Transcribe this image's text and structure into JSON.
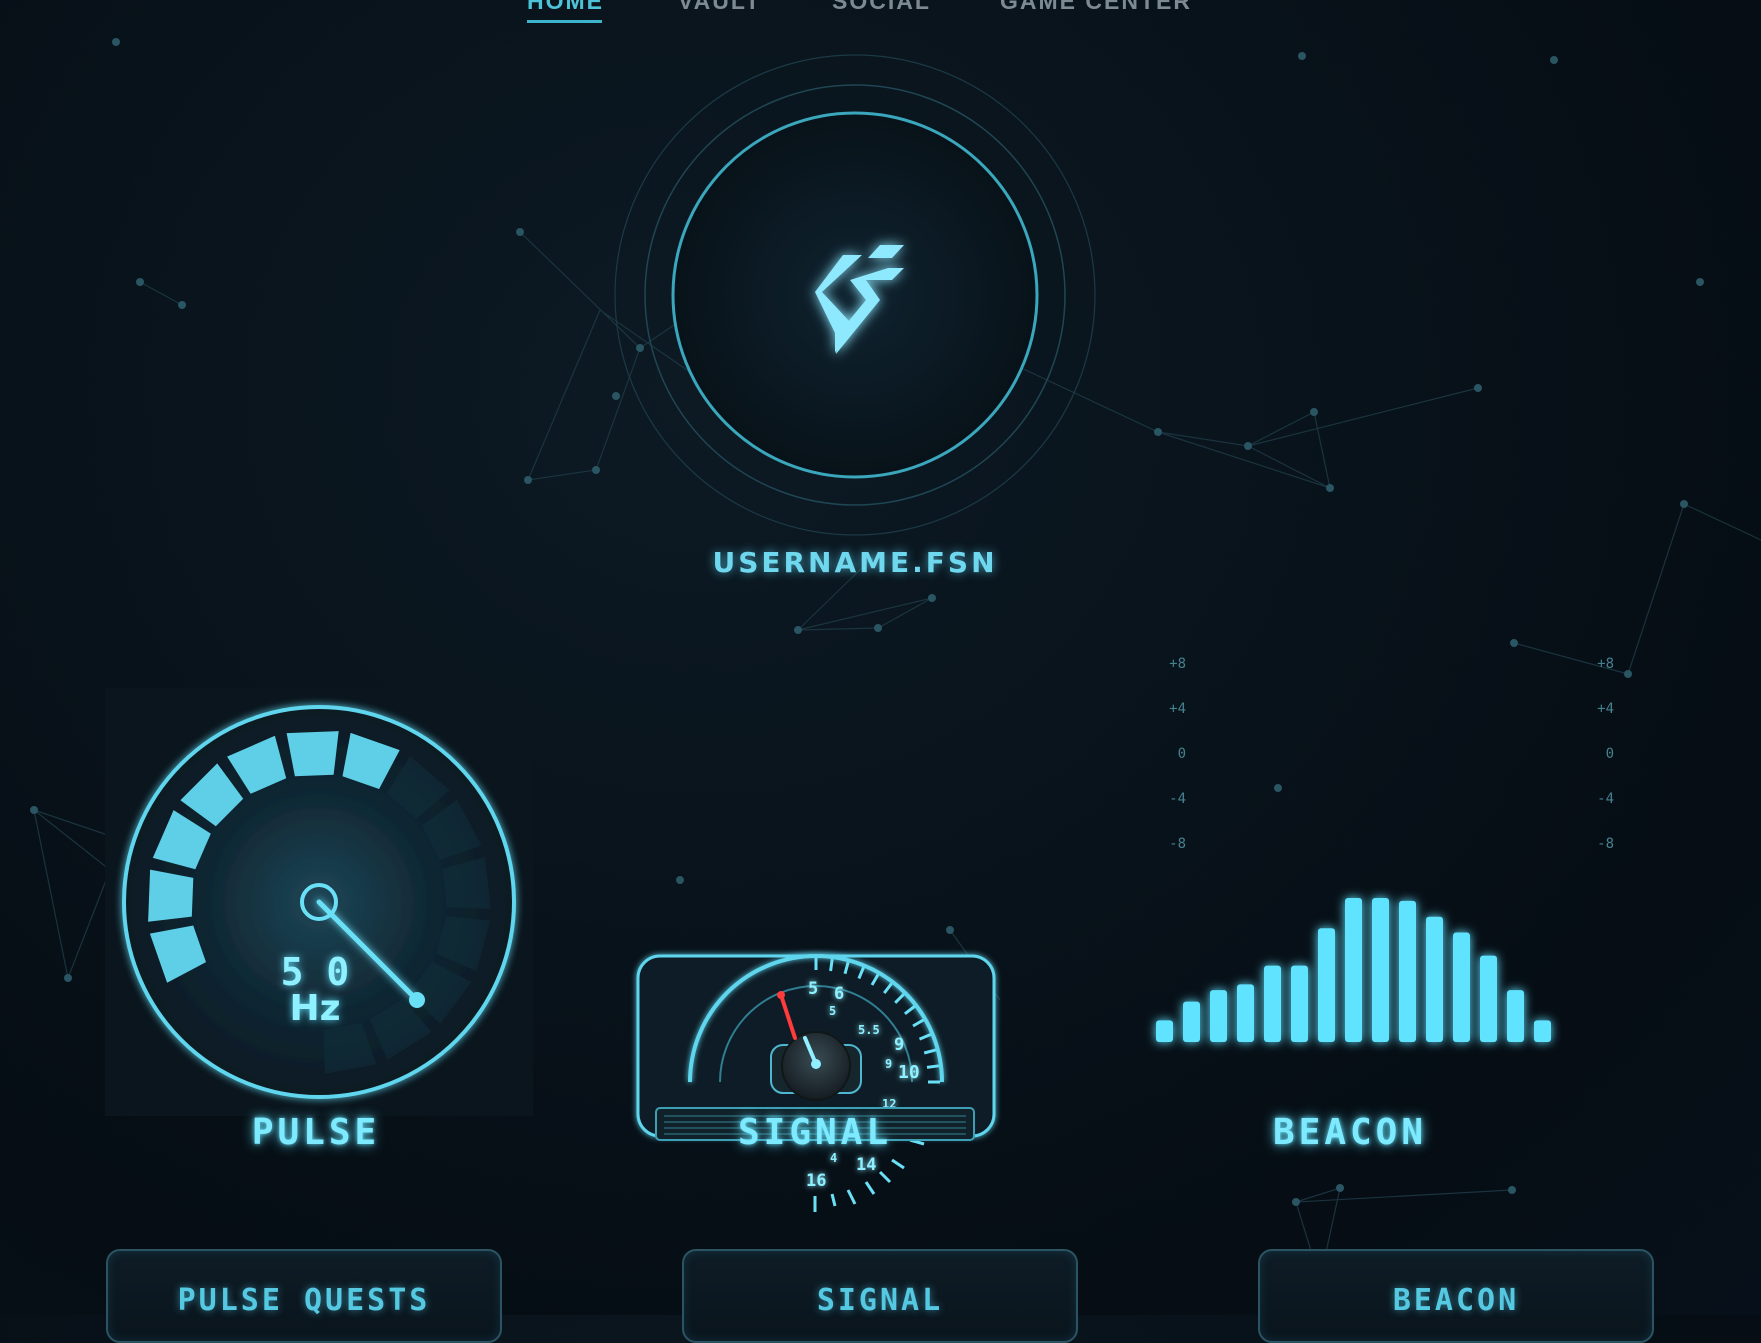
{
  "nav": {
    "items": [
      {
        "label": "HOME",
        "active": true
      },
      {
        "label": "VAULT",
        "active": false
      },
      {
        "label": "SOCIAL",
        "active": false
      },
      {
        "label": "GAME CENTER",
        "active": false
      }
    ]
  },
  "profile": {
    "username": "USERNAME.FSN",
    "logo_icon": "fsn-logo-icon"
  },
  "gauges": {
    "pulse": {
      "label": "PULSE",
      "value": "5 0",
      "unit": "Hz",
      "filled_segments": 7,
      "total_segments": 14
    },
    "signal": {
      "label": "SIGNAL",
      "dial_numbers": [
        "5",
        "6",
        "5",
        "5.5",
        "9",
        "9",
        "10",
        "12",
        "12",
        "4",
        "14",
        "16"
      ]
    },
    "beacon": {
      "label": "BEACON",
      "scale_left": [
        "+8",
        "+4",
        "0",
        "-4",
        "-8"
      ],
      "scale_right": [
        "+8",
        "+4",
        "0",
        "-4",
        "-8"
      ],
      "bar_levels": [
        0.15,
        0.28,
        0.36,
        0.4,
        0.53,
        0.53,
        0.79,
        1.0,
        1.0,
        0.98,
        0.87,
        0.76,
        0.6,
        0.36,
        0.15
      ]
    }
  },
  "cards": [
    {
      "label": "PULSE QUESTS"
    },
    {
      "label": "SIGNAL"
    },
    {
      "label": "BEACON"
    }
  ],
  "colors": {
    "accent": "#5fe3ff",
    "accent_dim": "#3db3cc",
    "needle_red": "#ff3b3b",
    "nav_inactive": "#7d8a93",
    "background": "#08121a"
  }
}
